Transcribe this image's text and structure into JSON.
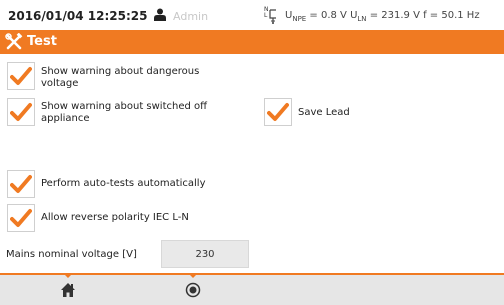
{
  "status": {
    "datetime": "2016/01/04 12:25:25",
    "user": "Admin",
    "plug_top": "N",
    "plug_mid": "L",
    "u_npe": "U",
    "u_npe_sub": "NPE",
    "u_npe_val": " = 0.8 V ",
    "u_ln": "U",
    "u_ln_sub": "LN",
    "u_ln_val": " = 231.9 V f = 50.1 Hz"
  },
  "header": {
    "title": "Test",
    "accent": "#f07a22"
  },
  "options": [
    {
      "label_1": "Show warning about dangerous",
      "label_2": "voltage",
      "checked": true
    },
    {
      "label_1": "Show warning about switched off",
      "label_2": "appliance",
      "checked": true
    },
    {
      "label_1": "Save Lead",
      "checked": true
    },
    {
      "label_1": "Perform auto-tests automatically",
      "checked": true
    },
    {
      "label_1": "Allow reverse polarity IEC L-N",
      "checked": true
    }
  ],
  "mains": {
    "label": "Mains nominal voltage [V]",
    "value": "230"
  },
  "bottom": {
    "icons": [
      "home-icon",
      "record-icon"
    ]
  }
}
